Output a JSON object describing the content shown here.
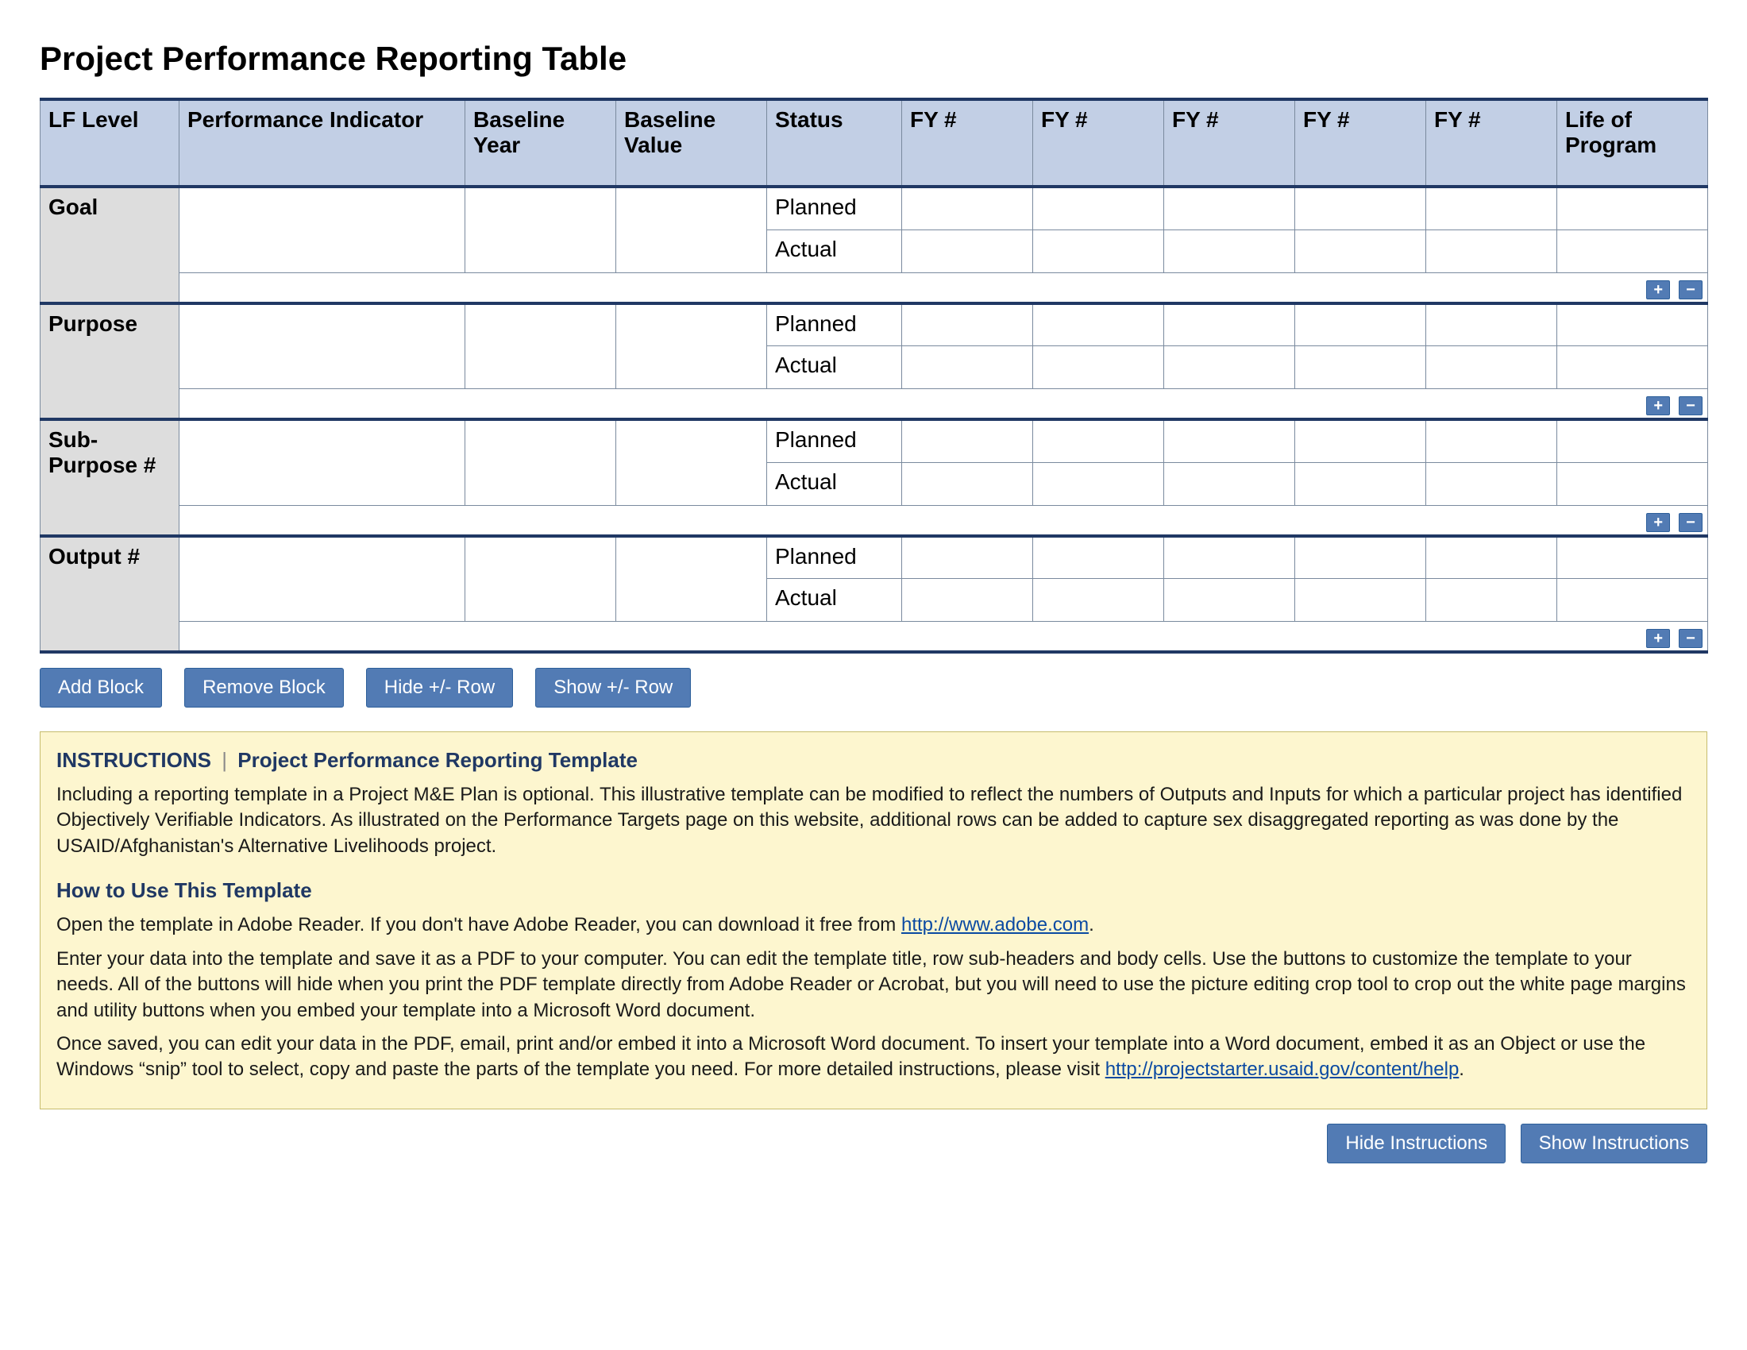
{
  "title": "Project Performance Reporting Table",
  "columns": {
    "lf_level": "LF Level",
    "indicator": "Performance Indicator",
    "baseline_year": "Baseline Year",
    "baseline_value": "Baseline Value",
    "status": "Status",
    "fy1": "FY #",
    "fy2": "FY #",
    "fy3": "FY #",
    "fy4": "FY #",
    "fy5": "FY #",
    "lop": "Life of Program"
  },
  "status_labels": {
    "planned": "Planned",
    "actual": "Actual"
  },
  "row_groups": [
    {
      "label": "Goal"
    },
    {
      "label": "Purpose"
    },
    {
      "label": "Sub-Purpose #"
    },
    {
      "label": "Output #"
    }
  ],
  "mini_buttons": {
    "plus": "+",
    "minus": "−"
  },
  "buttons": {
    "add_block": "Add Block",
    "remove_block": "Remove Block",
    "hide_row": "Hide +/- Row",
    "show_row": "Show +/- Row",
    "hide_instructions": "Hide Instructions",
    "show_instructions": "Show Instructions"
  },
  "instructions": {
    "heading_label": "INSTRUCTIONS",
    "heading_sub": "Project Performance Reporting Template",
    "para1": "Including a reporting template in a Project M&E Plan is optional. This illustrative template can be modified to reflect the numbers of Outputs and Inputs for which a particular project has identified Objectively Verifiable Indicators. As illustrated on the Performance Targets page on this website, additional rows can be added to capture sex disaggregated reporting as was done by the USAID/Afghanistan's Alternative Livelihoods project.",
    "how_to_heading": "How to Use This Template",
    "para2_pre": "Open the template in Adobe Reader. If you don't have Adobe Reader, you can download it free from ",
    "para2_link": "http://www.adobe.com",
    "para2_post": ".",
    "para3": "Enter your data into the template and save it as a PDF to your computer. You can edit the template title, row sub-headers and body cells. Use the buttons to customize the template to your needs. All of the buttons will hide when you print the PDF template directly from Adobe Reader or Acrobat, but you will need to use the picture editing crop tool to crop out the white page margins and utility buttons when you embed your template into a Microsoft Word document.",
    "para4_pre": "Once saved, you can edit your data in the PDF, email, print and/or embed it into a Microsoft Word document. To insert your template into a Word document, embed it as an Object or use the Windows “snip” tool to select, copy and paste the parts of the template you need. For more detailed instructions, please visit ",
    "para4_link": "http://projectstarter.usaid.gov/content/help",
    "para4_post": "."
  }
}
